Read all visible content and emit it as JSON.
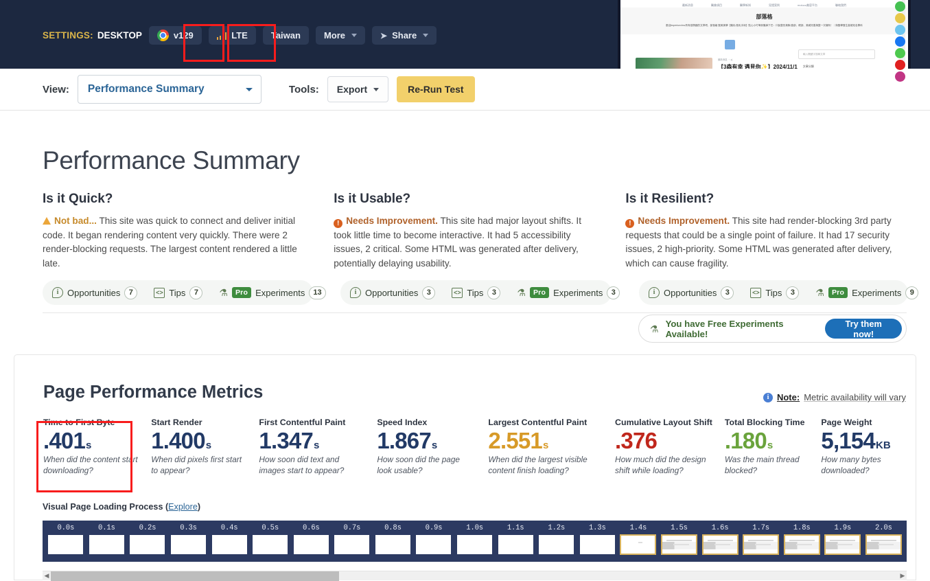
{
  "topbar": {
    "settings_label": "SETTINGS:",
    "device": "DESKTOP",
    "browser_version": "v129",
    "browser_icon": "chrome-logo-icon",
    "connection": "LTE",
    "connection_icon": "signal-bars-icon",
    "location": "Taiwan",
    "more_label": "More",
    "share_label": "Share",
    "share_icon": "paper-plane-icon"
  },
  "thumbnail": {
    "nav_items": [
      "最新消息",
      "醫美項目",
      "醫學新知",
      "見證案例",
      "molucu美容平台",
      "聯絡我們"
    ],
    "hero_title": "部落格",
    "hero_sub": "歡迎esperiunxlmc所有感興趣的文章吧，部落格 醫美美學【隆乳/音乳手術】貼心小叮嚀到隆鼻下巴：口製整形美胸 臉部、眼部、美威完善與整一次擁有！｜與醫學醫生高雄知名專科",
    "search_placeholder": "輸入關鍵字搜尋文章",
    "post_meta": "最新消息 ・ ▸|",
    "post_title": "【3森有幸 遇見你✨】2024/11/1",
    "right_label": "文章分類",
    "scroll_top_icon": "chevron-up-icon",
    "social_icons": [
      "phone-icon",
      "line-icon",
      "telegram-icon",
      "facebook-icon",
      "wechat-icon",
      "youtube-icon",
      "instagram-icon"
    ]
  },
  "toolbar": {
    "view_label": "View:",
    "view_value": "Performance Summary",
    "tools_label": "Tools:",
    "export_label": "Export",
    "rerun_label": "Re-Run Test",
    "dropdown_icon": "chevron-down-icon"
  },
  "summary": {
    "title": "Performance Summary",
    "cards": [
      {
        "heading": "Is it Quick?",
        "icon": "warning-triangle-icon",
        "verdict": "Not bad...",
        "verdict_class": "warn",
        "body": " This site was quick to connect and deliver initial code. It began rendering content very quickly. There were 2 render-blocking requests. The largest content rendered a little late.",
        "badges": {
          "opportunities_label": "Opportunities",
          "opportunities_count": "7",
          "tips_label": "Tips",
          "tips_count": "7",
          "pro_label": "Pro",
          "experiments_label": "Experiments",
          "experiments_count": "13"
        }
      },
      {
        "heading": "Is it Usable?",
        "icon": "alert-circle-icon",
        "verdict": "Needs Improvement.",
        "verdict_class": "needs",
        "body": " This site had major layout shifts. It took little time to become interactive. It had 5 accessibility issues, 2 critical. Some HTML was generated after delivery, potentially delaying usability.",
        "badges": {
          "opportunities_label": "Opportunities",
          "opportunities_count": "3",
          "tips_label": "Tips",
          "tips_count": "3",
          "pro_label": "Pro",
          "experiments_label": "Experiments",
          "experiments_count": "3"
        }
      },
      {
        "heading": "Is it Resilient?",
        "icon": "alert-circle-icon",
        "verdict": "Needs Improvement.",
        "verdict_class": "needs",
        "body": " This site had render-blocking 3rd party requests that could be a single point of failure. It had 17 security issues, 2 high-priority. Some HTML was generated after delivery, which can cause fragility.",
        "badges": {
          "opportunities_label": "Opportunities",
          "opportunities_count": "3",
          "tips_label": "Tips",
          "tips_count": "3",
          "pro_label": "Pro",
          "experiments_label": "Experiments",
          "experiments_count": "9"
        }
      }
    ],
    "free_experiments": {
      "icon": "flask-icon",
      "text": "You have Free Experiments Available!",
      "button": "Try them now!"
    }
  },
  "metrics_panel": {
    "title": "Page Performance Metrics",
    "note_icon": "info-circle-icon",
    "note_bold": "Note:",
    "note_text": " Metric availability will vary",
    "metrics": [
      {
        "name": "Time to First Byte",
        "value": ".401",
        "unit": "s",
        "color": "navy",
        "desc": "When did the content start downloading?"
      },
      {
        "name": "Start Render",
        "value": "1.400",
        "unit": "s",
        "color": "navy",
        "desc": "When did pixels first start to appear?"
      },
      {
        "name": "First Contentful Paint",
        "value": "1.347",
        "unit": "s",
        "color": "navy",
        "desc": "How soon did text and images start to appear?"
      },
      {
        "name": "Speed Index",
        "value": "1.867",
        "unit": "s",
        "color": "navy",
        "desc": "How soon did the page look usable?"
      },
      {
        "name": "Largest Contentful Paint",
        "value": "2.551",
        "unit": "s",
        "color": "warn",
        "desc": "When did the largest visible content finish loading?"
      },
      {
        "name": "Cumulative Layout Shift",
        "value": ".376",
        "unit": "",
        "color": "bad",
        "desc": "How much did the design shift while loading?"
      },
      {
        "name": "Total Blocking Time",
        "value": ".180",
        "unit": "s",
        "color": "good",
        "desc": "Was the main thread blocked?"
      },
      {
        "name": "Page Weight",
        "value": "5,154",
        "unit": "KB",
        "color": "navy",
        "desc": "How many bytes downloaded?"
      }
    ]
  },
  "filmstrip": {
    "label": "Visual Page Loading Process",
    "explore_open": "(",
    "explore_label": "Explore",
    "explore_close": ")",
    "frames": [
      {
        "time": "0.0s",
        "state": "blank"
      },
      {
        "time": "0.1s",
        "state": "blank"
      },
      {
        "time": "0.2s",
        "state": "blank"
      },
      {
        "time": "0.3s",
        "state": "blank"
      },
      {
        "time": "0.4s",
        "state": "blank"
      },
      {
        "time": "0.5s",
        "state": "blank"
      },
      {
        "time": "0.6s",
        "state": "blank"
      },
      {
        "time": "0.7s",
        "state": "blank"
      },
      {
        "time": "0.8s",
        "state": "blank"
      },
      {
        "time": "0.9s",
        "state": "blank"
      },
      {
        "time": "1.0s",
        "state": "blank"
      },
      {
        "time": "1.1s",
        "state": "blank"
      },
      {
        "time": "1.2s",
        "state": "blank"
      },
      {
        "time": "1.3s",
        "state": "blank"
      },
      {
        "time": "1.4s",
        "state": "faint"
      },
      {
        "time": "1.5s",
        "state": "shot"
      },
      {
        "time": "1.6s",
        "state": "shot"
      },
      {
        "time": "1.7s",
        "state": "shot"
      },
      {
        "time": "1.8s",
        "state": "shot"
      },
      {
        "time": "1.9s",
        "state": "shot"
      },
      {
        "time": "2.0s",
        "state": "shot"
      }
    ]
  },
  "scrollbar": {
    "left_arrow": "◀",
    "right_arrow": "▶"
  },
  "annotations": {
    "highlight_color": "#f81c1c",
    "boxes": [
      "connection-lte",
      "location-taiwan",
      "metric-time-to-first-byte"
    ]
  }
}
